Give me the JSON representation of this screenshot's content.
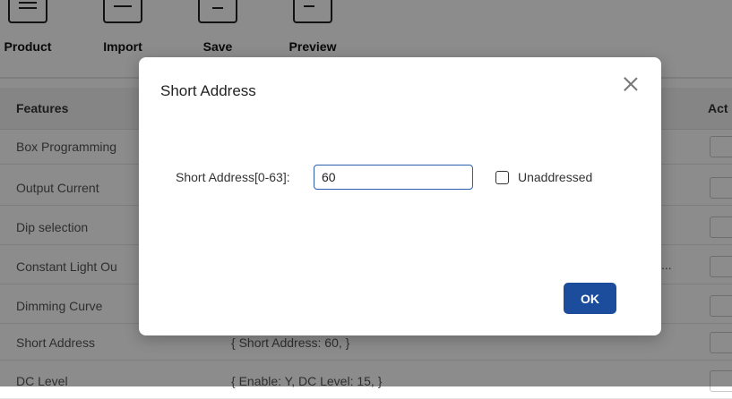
{
  "toolbar": {
    "items": [
      {
        "label": "Product",
        "icon": "product-icon"
      },
      {
        "label": "Import",
        "icon": "import-icon"
      },
      {
        "label": "Save",
        "icon": "save-icon"
      },
      {
        "label": "Preview",
        "icon": "preview-icon"
      }
    ]
  },
  "table": {
    "headers": {
      "features": "Features",
      "actions": "Act"
    },
    "rows": [
      {
        "feature": "Box Programming",
        "value": ""
      },
      {
        "feature": "Output Current",
        "value": ""
      },
      {
        "feature": "Dip selection",
        "value": ""
      },
      {
        "feature": "Constant Light Ou",
        "value": ""
      },
      {
        "feature": "Dimming Curve",
        "value": ""
      },
      {
        "feature": "Short Address",
        "value": "{ Short Address: 60, }"
      },
      {
        "feature": "DC Level",
        "value": "{ Enable: Y, DC Level: 15, }"
      }
    ],
    "truncated": "..."
  },
  "modal": {
    "title": "Short Address",
    "field_label": "Short Address[0-63]:",
    "field_value": "60",
    "checkbox_label": "Unaddressed",
    "checkbox_checked": false,
    "ok_label": "OK"
  },
  "colors": {
    "primary": "#1b4d9c",
    "overlay": "rgba(0,0,0,0.45)"
  }
}
